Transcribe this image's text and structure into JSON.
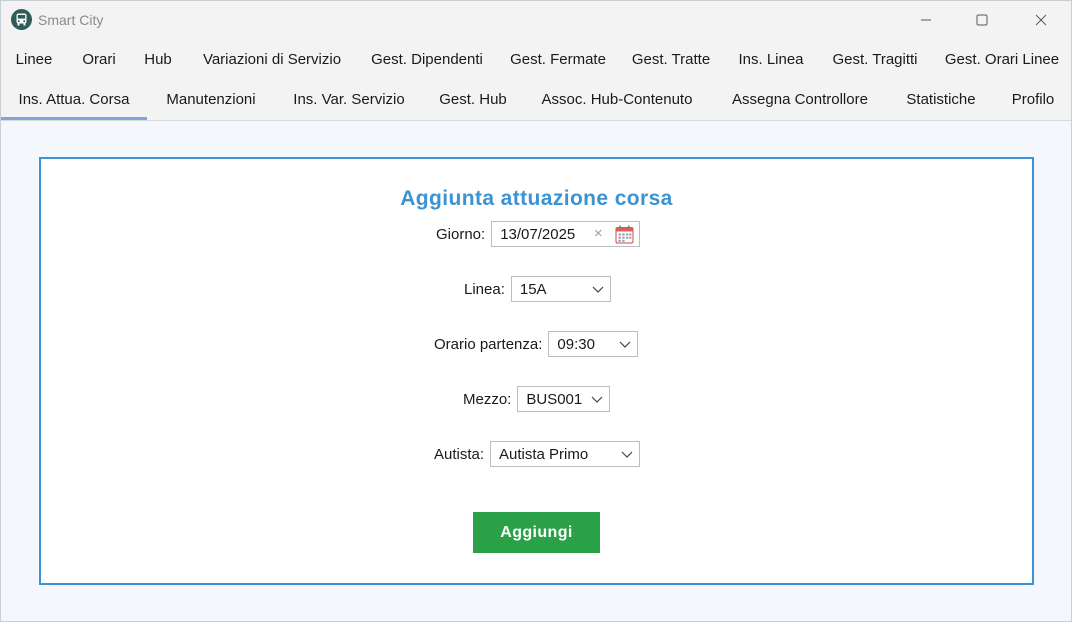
{
  "window": {
    "title": "Smart City",
    "icon": "bus-icon"
  },
  "tabs_row1": [
    {
      "label": "Linee"
    },
    {
      "label": "Orari"
    },
    {
      "label": "Hub"
    },
    {
      "label": "Variazioni di Servizio"
    },
    {
      "label": "Gest. Dipendenti"
    },
    {
      "label": "Gest. Fermate"
    },
    {
      "label": "Gest. Tratte"
    },
    {
      "label": "Ins. Linea"
    },
    {
      "label": "Gest. Tragitti"
    },
    {
      "label": "Gest. Orari Linee"
    }
  ],
  "tabs_row2": [
    {
      "label": "Ins. Attua. Corsa",
      "active": true
    },
    {
      "label": "Manutenzioni"
    },
    {
      "label": "Ins. Var. Servizio"
    },
    {
      "label": "Gest. Hub"
    },
    {
      "label": "Assoc. Hub-Contenuto"
    },
    {
      "label": "Assegna Controllore"
    },
    {
      "label": "Statistiche"
    },
    {
      "label": "Profilo"
    }
  ],
  "form": {
    "heading": "Aggiunta attuazione corsa",
    "giorno": {
      "label": "Giorno:",
      "value": "13/07/2025"
    },
    "linea": {
      "label": "Linea:",
      "value": "15A"
    },
    "orario": {
      "label": "Orario partenza:",
      "value": "09:30"
    },
    "mezzo": {
      "label": "Mezzo:",
      "value": "BUS001"
    },
    "autista": {
      "label": "Autista:",
      "value": "Autista Primo"
    },
    "submit_label": "Aggiungi"
  },
  "colors": {
    "accent": "#3b93d3",
    "submit": "#2ba147",
    "active_tab_indicator": "#7ea6d8"
  }
}
